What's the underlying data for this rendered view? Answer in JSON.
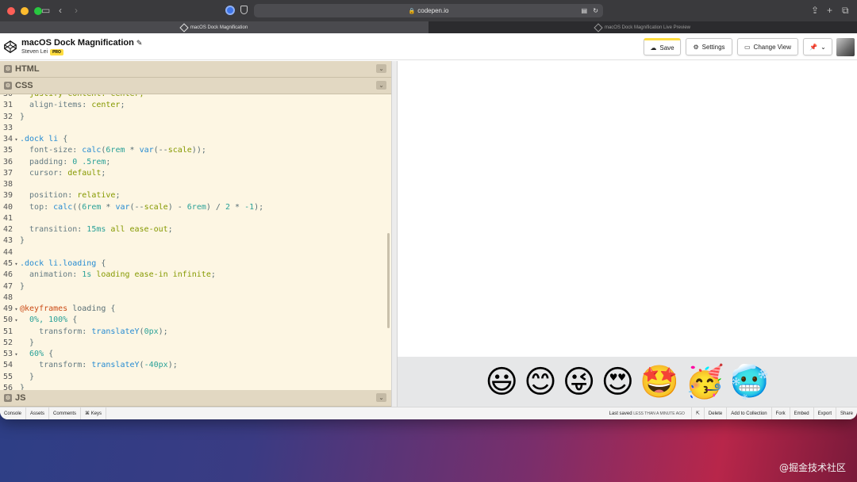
{
  "browser": {
    "url": "codepen.io",
    "tabs": [
      {
        "label": "macOS Dock Magnification",
        "active": true
      },
      {
        "label": "macOS Dock Magnification Live Preview",
        "active": false
      }
    ]
  },
  "header": {
    "title": "macOS Dock Magnification",
    "author": "Steven Lei",
    "badge": "PRO",
    "buttons": {
      "save": "Save",
      "settings": "Settings",
      "change_view": "Change View"
    }
  },
  "panels": {
    "html": "HTML",
    "css": "CSS",
    "js": "JS"
  },
  "code_lines": [
    {
      "n": "30",
      "fold": "",
      "tokens": [
        [
          "  justify-content: center;",
          "t-val"
        ]
      ]
    },
    {
      "n": "31",
      "fold": "",
      "tokens": [
        [
          "  align-items",
          "t-prop"
        ],
        [
          ": ",
          "t-pun"
        ],
        [
          "center",
          "t-val"
        ],
        [
          ";",
          "t-pun"
        ]
      ]
    },
    {
      "n": "32",
      "fold": "",
      "tokens": [
        [
          "}",
          "t-pun"
        ]
      ]
    },
    {
      "n": "33",
      "fold": "",
      "tokens": []
    },
    {
      "n": "34",
      "fold": "▾",
      "tokens": [
        [
          ".dock li",
          "t-sel"
        ],
        [
          " {",
          "t-pun"
        ]
      ]
    },
    {
      "n": "35",
      "fold": "",
      "tokens": [
        [
          "  font-size",
          "t-prop"
        ],
        [
          ": ",
          "t-pun"
        ],
        [
          "calc",
          "t-fn"
        ],
        [
          "(",
          "t-pun"
        ],
        [
          "6rem",
          "t-num"
        ],
        [
          " * ",
          "t-pun"
        ],
        [
          "var",
          "t-fn"
        ],
        [
          "(--",
          "t-pun"
        ],
        [
          "scale",
          "t-val"
        ],
        [
          "));",
          "t-pun"
        ]
      ]
    },
    {
      "n": "36",
      "fold": "",
      "tokens": [
        [
          "  padding",
          "t-prop"
        ],
        [
          ": ",
          "t-pun"
        ],
        [
          "0 .5rem",
          "t-num"
        ],
        [
          ";",
          "t-pun"
        ]
      ]
    },
    {
      "n": "37",
      "fold": "",
      "tokens": [
        [
          "  cursor",
          "t-prop"
        ],
        [
          ": ",
          "t-pun"
        ],
        [
          "default",
          "t-val"
        ],
        [
          ";",
          "t-pun"
        ]
      ]
    },
    {
      "n": "38",
      "fold": "",
      "tokens": []
    },
    {
      "n": "39",
      "fold": "",
      "tokens": [
        [
          "  position",
          "t-prop"
        ],
        [
          ": ",
          "t-pun"
        ],
        [
          "relative",
          "t-val"
        ],
        [
          ";",
          "t-pun"
        ]
      ]
    },
    {
      "n": "40",
      "fold": "",
      "tokens": [
        [
          "  top",
          "t-prop"
        ],
        [
          ": ",
          "t-pun"
        ],
        [
          "calc",
          "t-fn"
        ],
        [
          "((",
          "t-pun"
        ],
        [
          "6rem",
          "t-num"
        ],
        [
          " * ",
          "t-pun"
        ],
        [
          "var",
          "t-fn"
        ],
        [
          "(--",
          "t-pun"
        ],
        [
          "scale",
          "t-val"
        ],
        [
          ") - ",
          "t-pun"
        ],
        [
          "6rem",
          "t-num"
        ],
        [
          ") / ",
          "t-pun"
        ],
        [
          "2",
          "t-num"
        ],
        [
          " * ",
          "t-pun"
        ],
        [
          "-1",
          "t-num"
        ],
        [
          ");",
          "t-pun"
        ]
      ]
    },
    {
      "n": "41",
      "fold": "",
      "tokens": []
    },
    {
      "n": "42",
      "fold": "",
      "tokens": [
        [
          "  transition",
          "t-prop"
        ],
        [
          ": ",
          "t-pun"
        ],
        [
          "15ms",
          "t-num"
        ],
        [
          " all ease-out",
          "t-val"
        ],
        [
          ";",
          "t-pun"
        ]
      ]
    },
    {
      "n": "43",
      "fold": "",
      "tokens": [
        [
          "}",
          "t-pun"
        ]
      ]
    },
    {
      "n": "44",
      "fold": "",
      "tokens": []
    },
    {
      "n": "45",
      "fold": "▾",
      "tokens": [
        [
          ".dock li.loading",
          "t-sel"
        ],
        [
          " {",
          "t-pun"
        ]
      ]
    },
    {
      "n": "46",
      "fold": "",
      "tokens": [
        [
          "  animation",
          "t-prop"
        ],
        [
          ": ",
          "t-pun"
        ],
        [
          "1s",
          "t-num"
        ],
        [
          " loading ease-in infinite",
          "t-val"
        ],
        [
          ";",
          "t-pun"
        ]
      ]
    },
    {
      "n": "47",
      "fold": "",
      "tokens": [
        [
          "}",
          "t-pun"
        ]
      ]
    },
    {
      "n": "48",
      "fold": "",
      "tokens": []
    },
    {
      "n": "49",
      "fold": "▾",
      "tokens": [
        [
          "@keyframes",
          "t-kw"
        ],
        [
          " loading {",
          "t-pun"
        ]
      ]
    },
    {
      "n": "50",
      "fold": "▾",
      "tokens": [
        [
          "  0%, 100%",
          "t-num"
        ],
        [
          " {",
          "t-pun"
        ]
      ]
    },
    {
      "n": "51",
      "fold": "",
      "tokens": [
        [
          "    transform",
          "t-prop"
        ],
        [
          ": ",
          "t-pun"
        ],
        [
          "translateY",
          "t-fn"
        ],
        [
          "(",
          "t-pun"
        ],
        [
          "0px",
          "t-num"
        ],
        [
          ");",
          "t-pun"
        ]
      ]
    },
    {
      "n": "52",
      "fold": "",
      "tokens": [
        [
          "  }",
          "t-pun"
        ]
      ]
    },
    {
      "n": "53",
      "fold": "▾",
      "tokens": [
        [
          "  60%",
          "t-num"
        ],
        [
          " {",
          "t-pun"
        ]
      ]
    },
    {
      "n": "54",
      "fold": "",
      "tokens": [
        [
          "    transform",
          "t-prop"
        ],
        [
          ": ",
          "t-pun"
        ],
        [
          "translateY",
          "t-fn"
        ],
        [
          "(",
          "t-pun"
        ],
        [
          "-40px",
          "t-num"
        ],
        [
          ");",
          "t-pun"
        ]
      ]
    },
    {
      "n": "55",
      "fold": "",
      "tokens": [
        [
          "  }",
          "t-pun"
        ]
      ]
    },
    {
      "n": "56",
      "fold": "",
      "tokens": [
        [
          "}",
          "t-pun"
        ]
      ]
    }
  ],
  "dock_emojis": [
    "😃",
    "😊",
    "😜",
    "😍",
    "🤩",
    "🥳",
    "🥶"
  ],
  "footer": {
    "left": [
      "Console",
      "Assets",
      "Comments",
      "⌘ Keys"
    ],
    "last_saved": "Last saved",
    "last_saved_when": "LESS THAN A MINUTE AGO",
    "right": [
      "Delete",
      "Add to Collection",
      "Fork",
      "Embed",
      "Export",
      "Share"
    ]
  },
  "watermark": "@掘金技术社区"
}
